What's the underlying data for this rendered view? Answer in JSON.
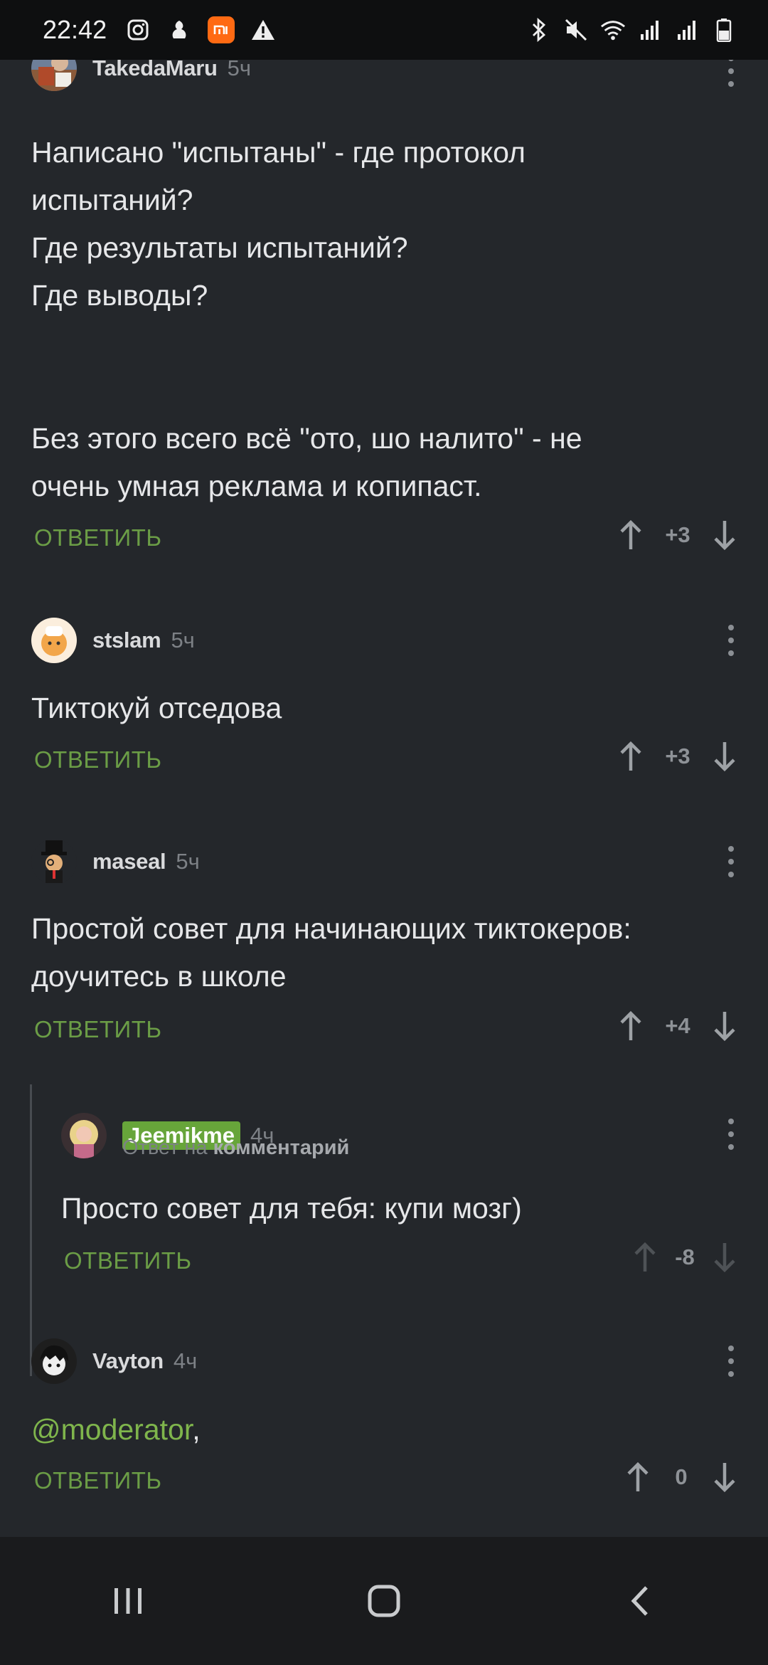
{
  "status_bar": {
    "time": "22:42",
    "left_icons": [
      "instagram-icon",
      "app-notification-icon",
      "mi-icon",
      "warning-icon"
    ],
    "right_icons": [
      "bluetooth-icon",
      "mute-icon",
      "wifi-icon",
      "signal-icon",
      "signal-icon",
      "battery-icon"
    ]
  },
  "reply_label": "ОТВЕТИТЬ",
  "comments": [
    {
      "author": "TakedaMaru",
      "age": "5ч",
      "lines": [
        "Написано \"испытаны\" - где протокол",
        "испытаний?",
        "Где результаты испытаний?",
        "Где выводы?",
        "Без этого всего всё \"ото, шо налито\" - не",
        "очень умная реклама и копипаст."
      ],
      "score": "+3"
    },
    {
      "author": "stslam",
      "age": "5ч",
      "lines": [
        "Тиктокуй отседова"
      ],
      "score": "+3"
    },
    {
      "author": "maseal",
      "age": "5ч",
      "lines": [
        "Простой совет для начинающих тиктокеров:",
        "доучитесь в школе"
      ],
      "score": "+4"
    },
    {
      "author": "Jeemikme",
      "age": "4ч",
      "reply_to_prefix": "Ответ на",
      "reply_to_target": "комментарий",
      "lines": [
        "Просто совет для тебя: купи мозг)"
      ],
      "score": "-8"
    },
    {
      "author": "Vayton",
      "age": "4ч",
      "mention": "@moderator",
      "mention_suffix": ",",
      "score": "0"
    }
  ],
  "nav": [
    "recents-button",
    "home-button",
    "back-button"
  ]
}
